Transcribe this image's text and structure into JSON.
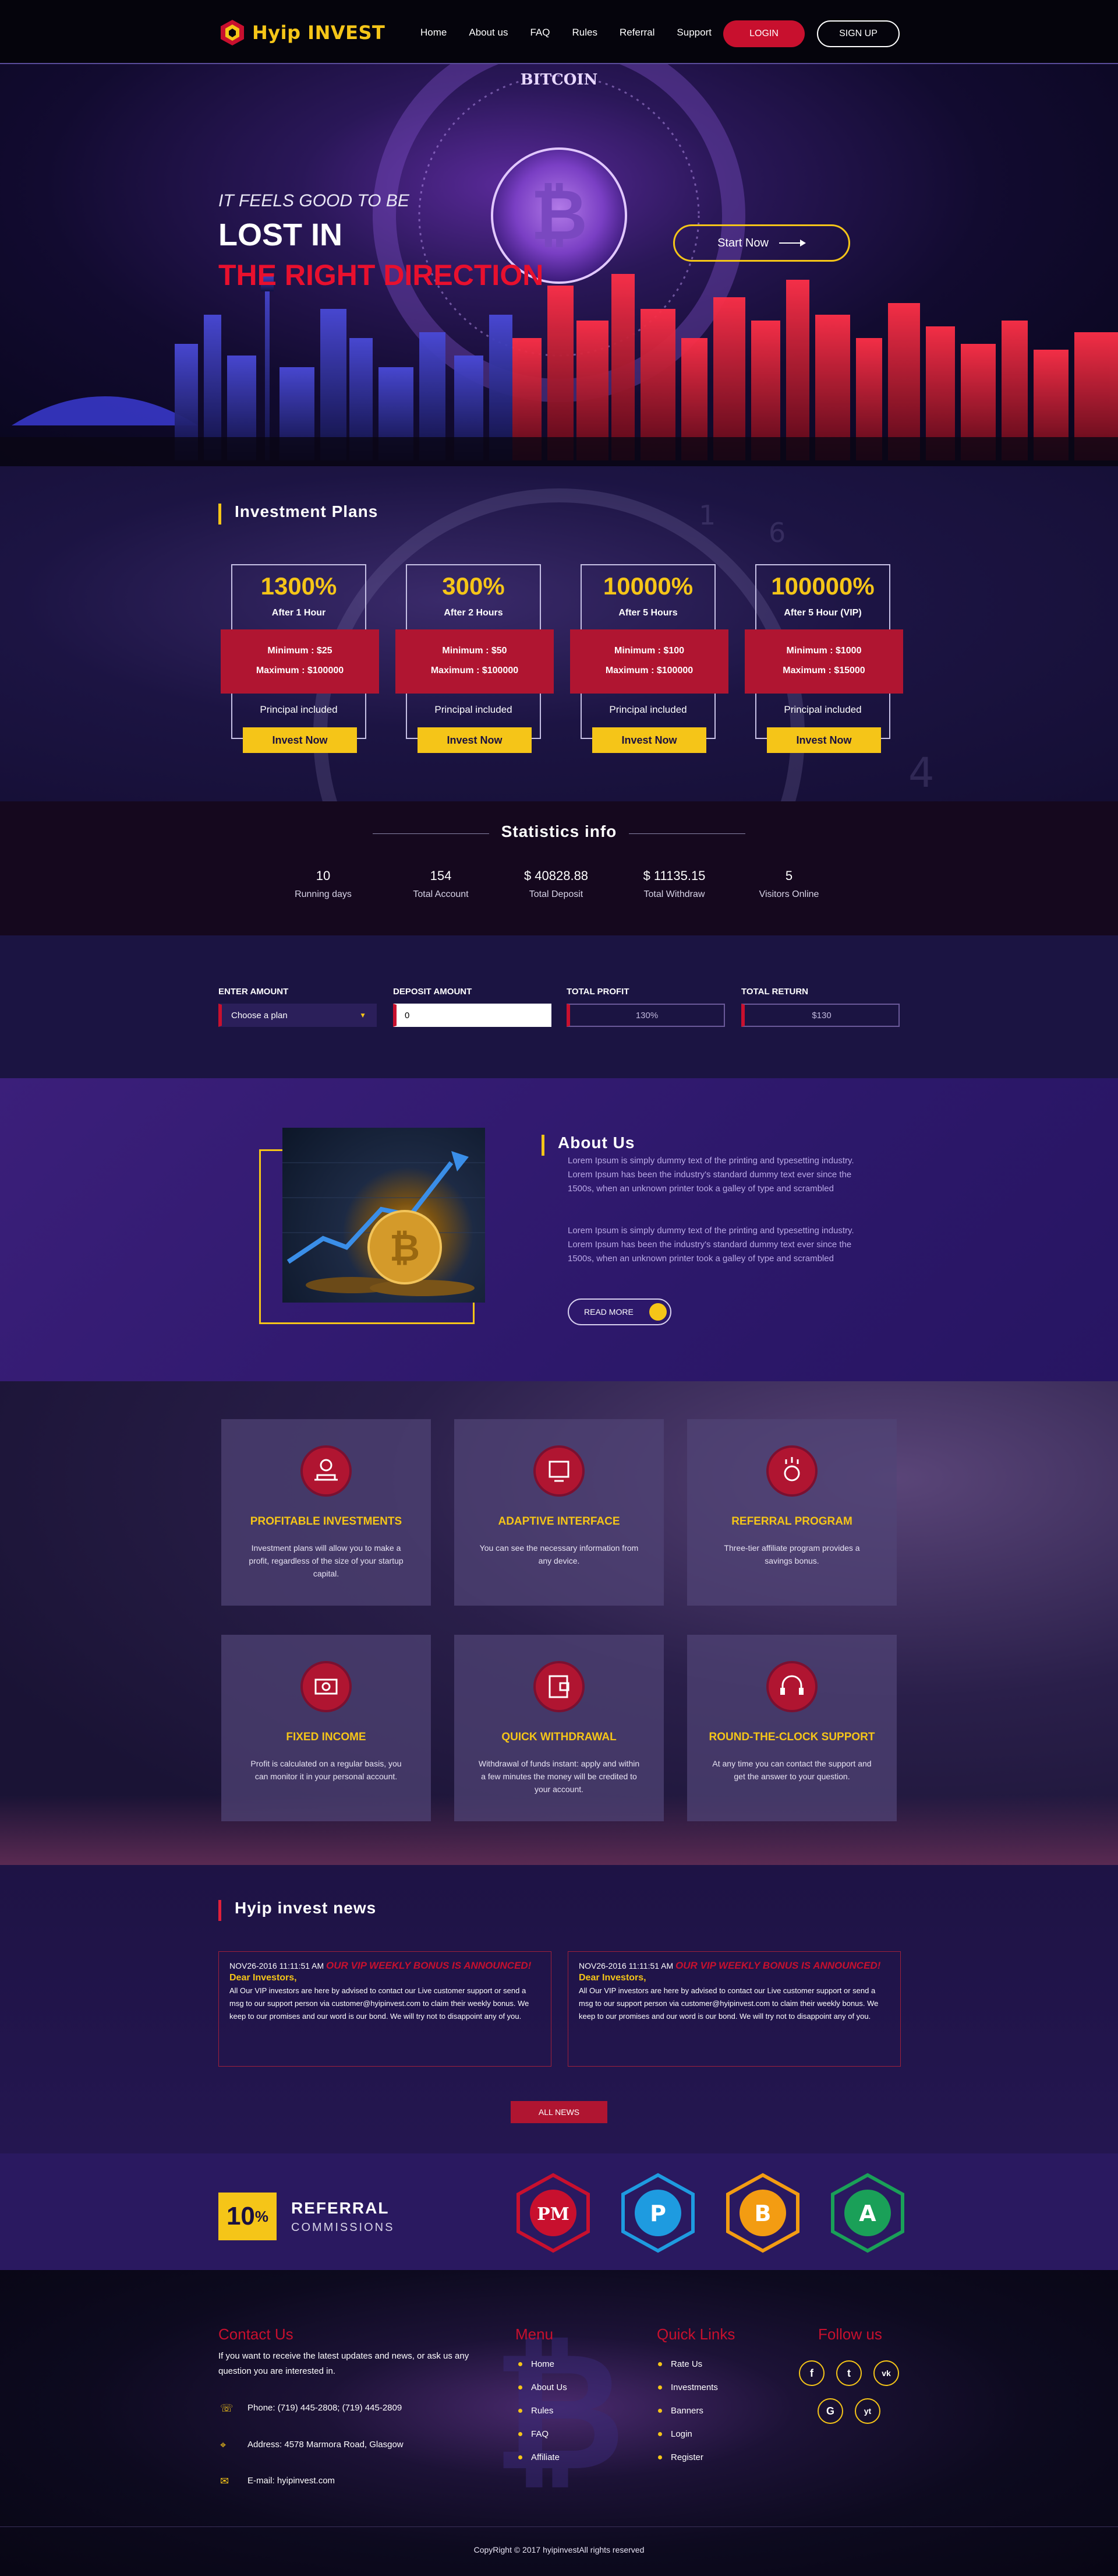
{
  "header": {
    "logo": {
      "word1": "Hyip",
      "word2": "INVEST"
    },
    "nav": [
      "Home",
      "About us",
      "FAQ",
      "Rules",
      "Referral",
      "Support"
    ],
    "login_label": "LOGIN",
    "signup_label": "SIGN UP"
  },
  "hero": {
    "tagline": "IT FEELS GOOD TO BE",
    "title_line1": "LOST IN",
    "title_line2": "THE RIGHT DIRECTION",
    "coin_label": "BITCOIN",
    "start_label": "Start Now"
  },
  "plans": {
    "title": "Investment Plans",
    "items": [
      {
        "percent": "1300%",
        "after": "After 1 Hour",
        "minimum": "Minimum : $25",
        "maximum": "Maximum : $100000",
        "principal": "Principal included",
        "button": "Invest Now"
      },
      {
        "percent": "300%",
        "after": "After 2 Hours",
        "minimum": "Minimum : $50",
        "maximum": "Maximum : $100000",
        "principal": "Principal included",
        "button": "Invest Now"
      },
      {
        "percent": "10000%",
        "after": "After 5 Hours",
        "minimum": "Minimum : $100",
        "maximum": "Maximum : $100000",
        "principal": "Principal included",
        "button": "Invest Now"
      },
      {
        "percent": "100000%",
        "after": "After 5 Hour (VIP)",
        "minimum": "Minimum : $1000",
        "maximum": "Maximum : $15000",
        "principal": "Principal included",
        "button": "Invest Now"
      }
    ]
  },
  "stats": {
    "title": "Statistics info",
    "items": [
      {
        "value": "10",
        "label": "Running days"
      },
      {
        "value": "154",
        "label": "Total Account"
      },
      {
        "value": "$ 40828.88",
        "label": "Total Deposit"
      },
      {
        "value": "$ 11135.15",
        "label": "Total Withdraw"
      },
      {
        "value": "5",
        "label": "Visitors Online"
      }
    ]
  },
  "calculator": {
    "enter_amount_label": "ENTER AMOUNT",
    "plan_placeholder": "Choose a plan",
    "deposit_label": "DEPOSIT AMOUNT",
    "deposit_value": "0",
    "profit_label": "TOTAL PROFIT",
    "profit_value": "130%",
    "return_label": "TOTAL RETURN",
    "return_value": "$130"
  },
  "about": {
    "title": "About Us",
    "para1": "Lorem Ipsum is simply dummy text of the printing and typesetting industry. Lorem Ipsum has been the industry's standard dummy text ever since the 1500s, when an unknown printer took a galley of type and scrambled",
    "para2": "Lorem Ipsum is simply dummy text of the printing and typesetting industry. Lorem Ipsum has been the industry's standard dummy text ever since the 1500s, when an unknown printer took a galley of type and scrambled",
    "read_more": "READ MORE"
  },
  "features": [
    {
      "title": "PROFITABLE INVESTMENTS",
      "desc": "Investment plans will allow you to make a profit, regardless of the size of your startup capital.",
      "icon": "coins-hand-icon"
    },
    {
      "title": "ADAPTIVE INTERFACE",
      "desc": "You can see the necessary information from any device.",
      "icon": "devices-icon"
    },
    {
      "title": "REFERRAL PROGRAM",
      "desc": "Three-tier affiliate program provides a savings bonus.",
      "icon": "referral-icon"
    },
    {
      "title": "FIXED INCOME",
      "desc": "Profit is calculated on a regular basis, you can monitor it in your personal account.",
      "icon": "banknote-icon"
    },
    {
      "title": "QUICK WITHDRAWAL",
      "desc": "Withdrawal of funds instant: apply and within a few minutes the money will be credited to your account.",
      "icon": "wallet-icon"
    },
    {
      "title": "ROUND-THE-CLOCK SUPPORT",
      "desc": "At any time you can contact the support and get the answer to your question.",
      "icon": "headset-icon"
    }
  ],
  "news": {
    "title": "Hyip invest news",
    "items": [
      {
        "date": "NOV26-2016 11:11:51 AM",
        "headline": "OUR VIP WEEKLY BONUS IS ANNOUNCED!",
        "dear": "Dear Investors,",
        "body": "All Our VIP investors are here by advised to contact our Live customer support or send a msg to our support person via customer@hyipinvest.com to claim their weekly bonus. We keep to our promises and our word is our bond. We will try not to disappoint any of you."
      },
      {
        "date": "NOV26-2016 11:11:51 AM",
        "headline": "OUR VIP WEEKLY BONUS IS ANNOUNCED!",
        "dear": "Dear Investors,",
        "body": "All Our VIP investors are here by advised to contact our Live customer support or send a msg to our support person via customer@hyipinvest.com to claim their weekly bonus. We keep to our promises and our word is our bond. We will try not to disappoint any of you."
      }
    ],
    "all_news": "ALL NEWS"
  },
  "referral": {
    "percent": "10",
    "percent_sign": "%",
    "title": "REFERRAL",
    "subtitle": "COMMISSIONS",
    "payments": [
      {
        "label": "PM",
        "color": "#c8102e",
        "icon": "perfect-money-icon"
      },
      {
        "label": "P",
        "color": "#1e9be0",
        "icon": "payeer-icon"
      },
      {
        "label": "B",
        "color": "#f39c12",
        "icon": "bitcoin-icon"
      },
      {
        "label": "A",
        "color": "#1aa058",
        "icon": "advcash-icon"
      }
    ]
  },
  "footer": {
    "contact_title": "Contact Us",
    "contact_text": "If you want to receive the latest updates and news, or ask us any question you are interested in.",
    "phone": "Phone: (719) 445-2808; (719) 445-2809",
    "address": "Address: 4578 Marmora Road, Glasgow",
    "email": "E-mail: hyipinvest.com",
    "menu_title": "Menu",
    "menu": [
      "Home",
      "About Us",
      "Rules",
      "FAQ",
      "Affiliate"
    ],
    "quick_title": "Quick Links",
    "quick": [
      "Rate Us",
      "Investments",
      "Banners",
      "Login",
      "Register"
    ],
    "follow_title": "Follow us",
    "social": [
      {
        "label": "f",
        "icon": "facebook-icon"
      },
      {
        "label": "t",
        "icon": "twitter-icon"
      },
      {
        "label": "vk",
        "icon": "vk-icon"
      },
      {
        "label": "G",
        "icon": "google-plus-icon"
      },
      {
        "label": "yt",
        "icon": "youtube-icon"
      }
    ],
    "copyright": "CopyRight © 2017 hyipinvestAll rights reserved"
  },
  "colors": {
    "accent_yellow": "#f5c518",
    "accent_red": "#c8102e",
    "deep_purple": "#1b1442"
  }
}
